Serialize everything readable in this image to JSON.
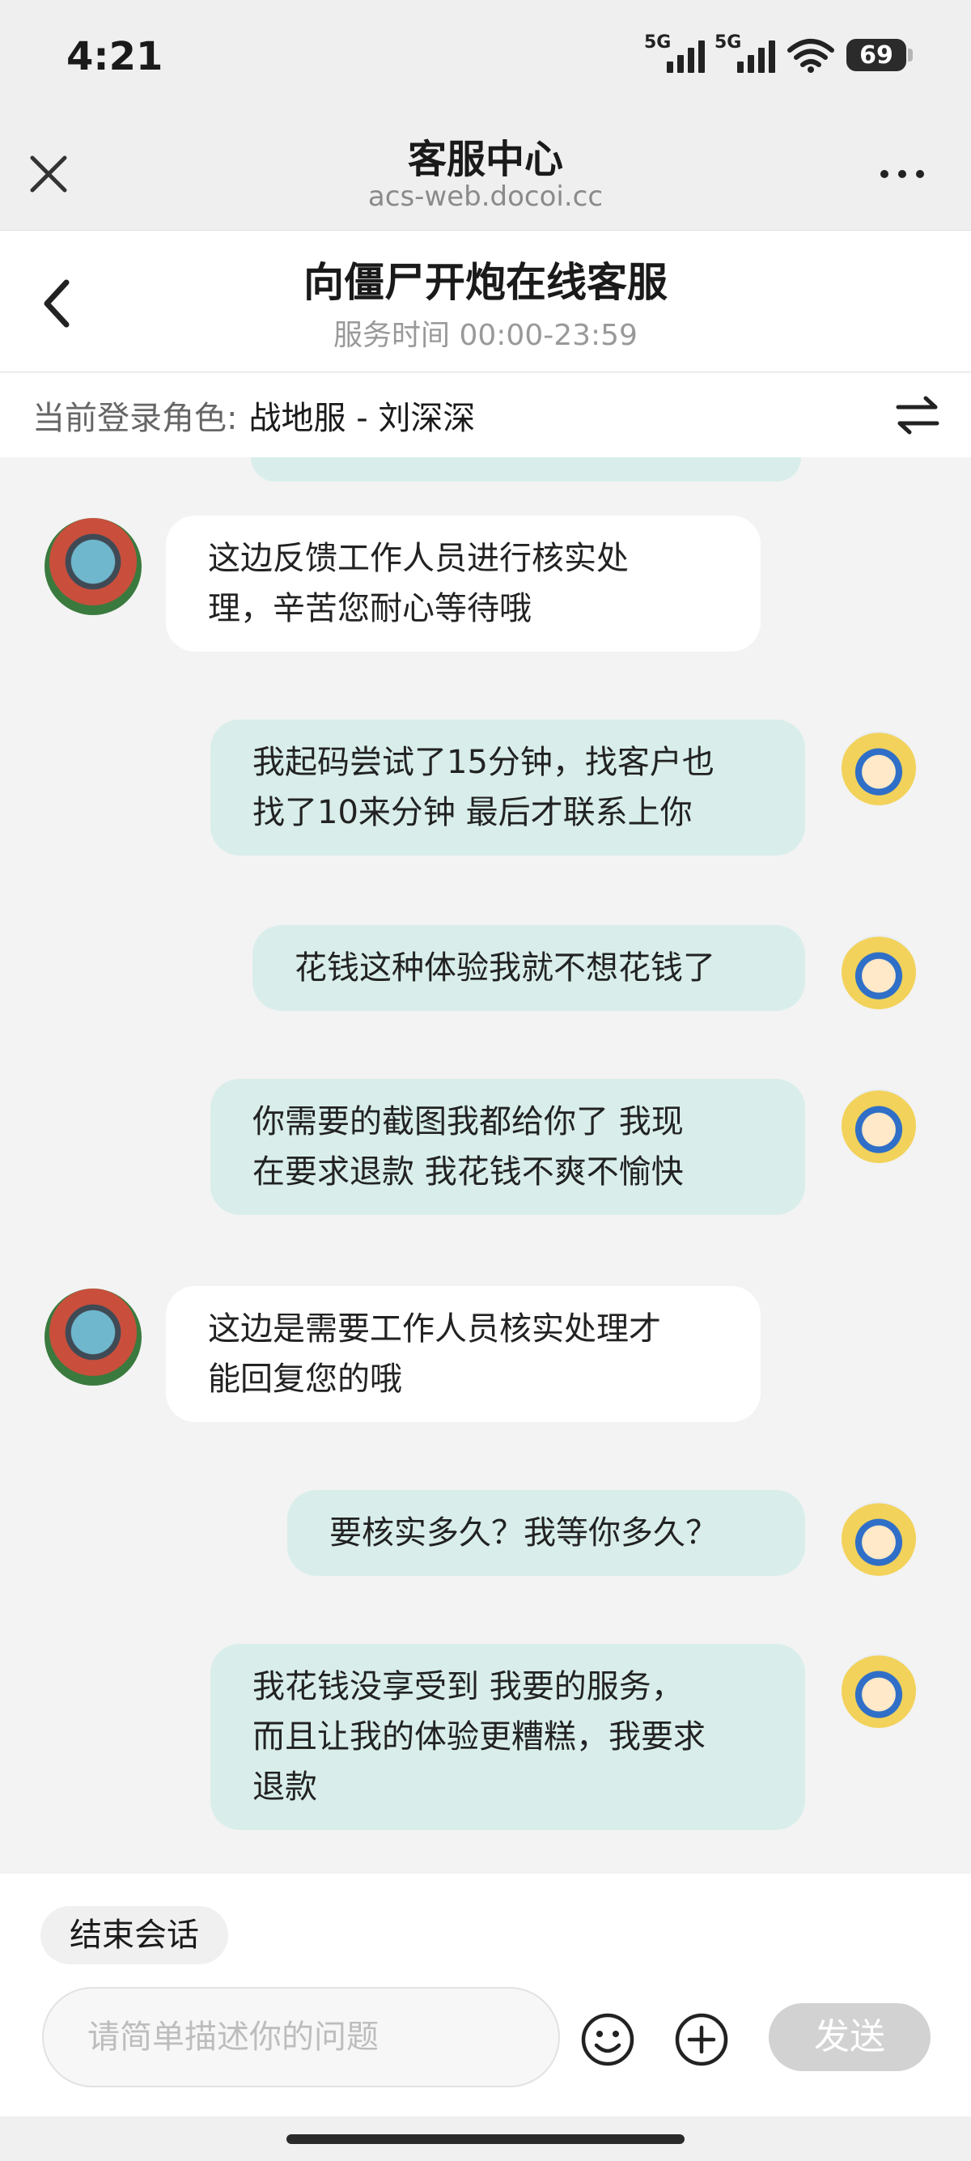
{
  "status_bar": {
    "time": "4:21",
    "network_1": "5G",
    "network_2": "5G",
    "battery": "69",
    "icons": [
      "signal-icon",
      "signal-icon",
      "wifi-icon",
      "battery-icon"
    ]
  },
  "browser": {
    "title": "客服中心",
    "url": "acs-web.docoi.cc",
    "icons": [
      "close-icon",
      "more-icon"
    ]
  },
  "chat_header": {
    "title": "向僵尸开炮在线客服",
    "service_hours": "服务时间 00:00-23:59"
  },
  "role_bar": {
    "label": "当前登录角色:",
    "value": "战地服 - 刘深深"
  },
  "messages": [
    {
      "sender": "agent",
      "line1": "这边反馈工作人员进行核实处",
      "line2": "理，辛苦您耐心等待哦"
    },
    {
      "sender": "user",
      "line1": "我起码尝试了15分钟，找客户也",
      "line2": "找了10来分钟 最后才联系上你"
    },
    {
      "sender": "user",
      "line1": "花钱这种体验我就不想花钱了"
    },
    {
      "sender": "user",
      "line1": "你需要的截图我都给你了 我现",
      "line2": "在要求退款 我花钱不爽不愉快"
    },
    {
      "sender": "agent",
      "line1": "这边是需要工作人员核实处理才",
      "line2": "能回复您的哦"
    },
    {
      "sender": "user",
      "line1": "要核实多久？我等你多久？"
    },
    {
      "sender": "user",
      "line1": "我花钱没享受到 我要的服务，",
      "line2": "而且让我的体验更糟糕，我要求",
      "line3": "退款"
    }
  ],
  "bottom": {
    "end_session": "结束会话",
    "input_placeholder": "请简单描述你的问题",
    "send_label": "发送",
    "icons": [
      "emoji-icon",
      "plus-icon"
    ]
  },
  "colors": {
    "user_bubble": "#d9eeea",
    "agent_bubble": "#ffffff",
    "background": "#f3f3f3",
    "send_disabled": "#d2d2d2"
  }
}
